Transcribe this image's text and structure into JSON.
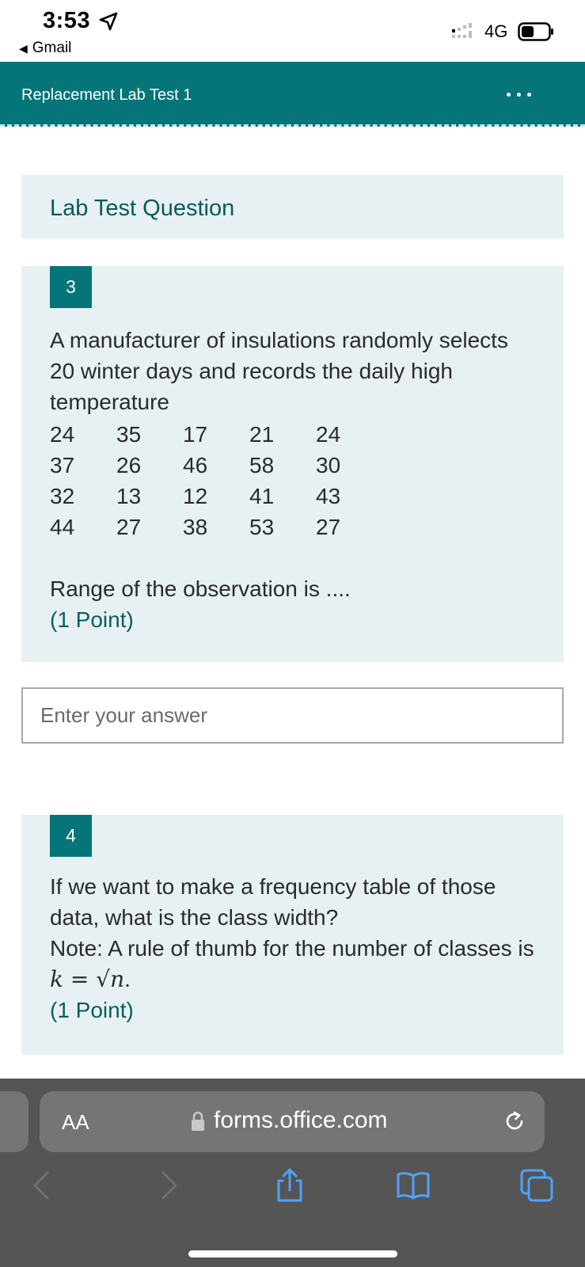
{
  "status_bar": {
    "time": "3:53",
    "back_app": "Gmail",
    "network": "4G"
  },
  "header": {
    "form_title": "Replacement Lab Test 1",
    "accent_color": "#057579"
  },
  "section": {
    "title": "Lab Test Question"
  },
  "questions": [
    {
      "number": "3",
      "text": "A manufacturer of insulations randomly selects 20 winter days and records the daily high temperature",
      "data_rows": [
        [
          "24",
          "35",
          "17",
          "21",
          "24"
        ],
        [
          "37",
          "26",
          "46",
          "58",
          "30"
        ],
        [
          "32",
          "13",
          "12",
          "41",
          "43"
        ],
        [
          "44",
          "27",
          "38",
          "53",
          "27"
        ]
      ],
      "prompt": "Range of the observation is ....",
      "points": "(1 Point)",
      "answer": {
        "placeholder": "Enter your answer",
        "value": ""
      }
    },
    {
      "number": "4",
      "text": "If we want to make a frequency table of those data, what is the class width?",
      "note_prefix": "Note: A rule of thumb for the number of classes is",
      "formula": "k = √n",
      "note_suffix": ".",
      "points": "(1 Point)"
    }
  ],
  "browser": {
    "text_size_label": "AA",
    "url": "forms.office.com",
    "icons": [
      "lock-icon",
      "reload-icon",
      "back-icon",
      "forward-icon",
      "share-icon",
      "bookmarks-icon",
      "tabs-icon"
    ]
  }
}
